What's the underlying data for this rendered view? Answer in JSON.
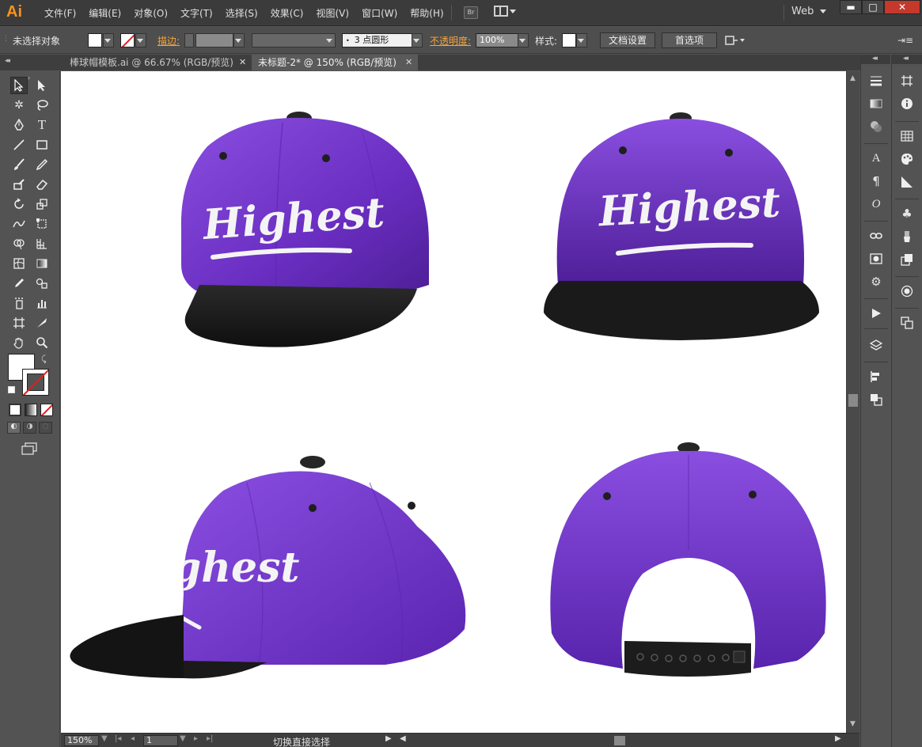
{
  "app": {
    "logo": "Ai"
  },
  "menu": {
    "items": [
      "文件(F)",
      "编辑(E)",
      "对象(O)",
      "文字(T)",
      "选择(S)",
      "效果(C)",
      "视图(V)",
      "窗口(W)",
      "帮助(H)"
    ],
    "bridge_label": "Br",
    "workspace": "Web"
  },
  "window_controls": {
    "minimize": "▬",
    "maximize": "□",
    "close": "✕"
  },
  "control_bar": {
    "selection_status": "未选择对象",
    "stroke_label": "描边:",
    "brush_value": "3 点圆形",
    "opacity_label": "不透明度:",
    "opacity_value": "100%",
    "style_label": "样式:",
    "doc_setup_button": "文档设置",
    "preferences_button": "首选项"
  },
  "tabs": [
    {
      "label": "棒球帽模板.ai @ 66.67% (RGB/预览)",
      "active": false
    },
    {
      "label": "未标题-2* @ 150% (RGB/预览)",
      "active": true
    }
  ],
  "canvas_artwork": {
    "embroidery_text": "Highest",
    "colors": {
      "crown": "#6b2fc4",
      "crown_light": "#8a4ee0",
      "brim": "#1c1c1c",
      "button": "#2a2a2a",
      "thread": "#f4f4f4"
    }
  },
  "status_bar": {
    "zoom": "150%",
    "artboard": "1",
    "current_tool": "切换直接选择"
  },
  "colors": {
    "accent": "#f7931e",
    "panel_bg": "#535353",
    "menubar_bg": "#3b3b3b",
    "canvas_bg": "#ffffff",
    "warning_label": "#f7a33b"
  }
}
